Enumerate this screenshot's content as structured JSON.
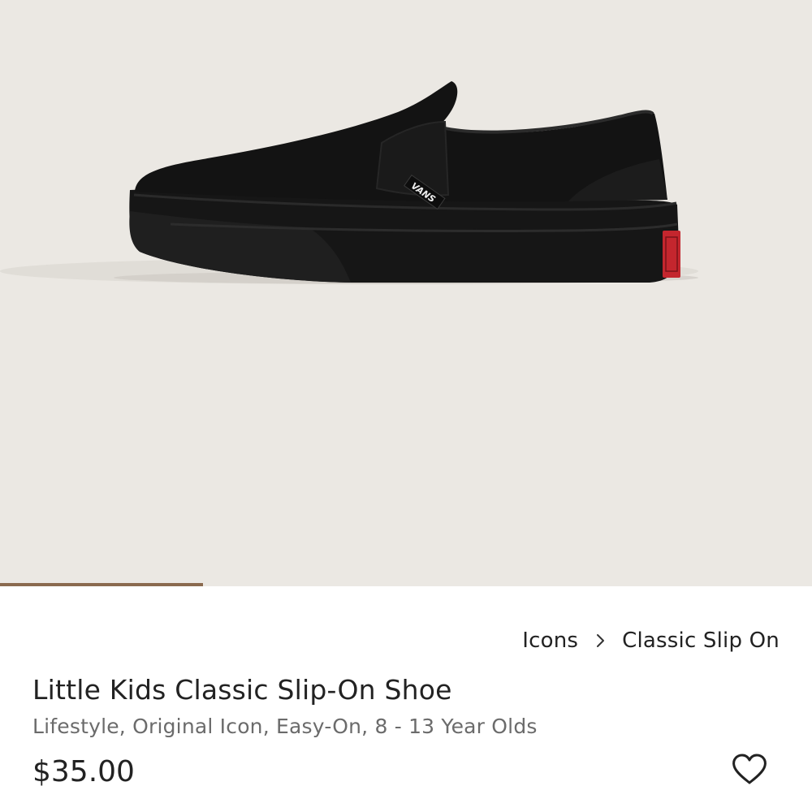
{
  "product": {
    "image_alt": "Little Kids Classic Slip-On Shoe",
    "logo_text": "VANS",
    "gallery_progress": 0.25,
    "breadcrumb": [
      {
        "label": "Icons"
      },
      {
        "label": "Classic Slip On"
      }
    ],
    "title": "Little Kids Classic Slip-On Shoe",
    "subtitle": "Lifestyle, Original Icon, Easy-On, 8 - 13 Year Olds",
    "price": "$35.00"
  },
  "icons": {
    "breadcrumb_separator": "chevron-right-icon",
    "wishlist": "heart-icon"
  },
  "colors": {
    "gallery_background": "#ebe8e3",
    "progress": "#8a6a4f",
    "shoe": "#121212",
    "heel_tab": "#c4262e",
    "text_primary": "#222222",
    "text_secondary": "#6b6b6b"
  }
}
